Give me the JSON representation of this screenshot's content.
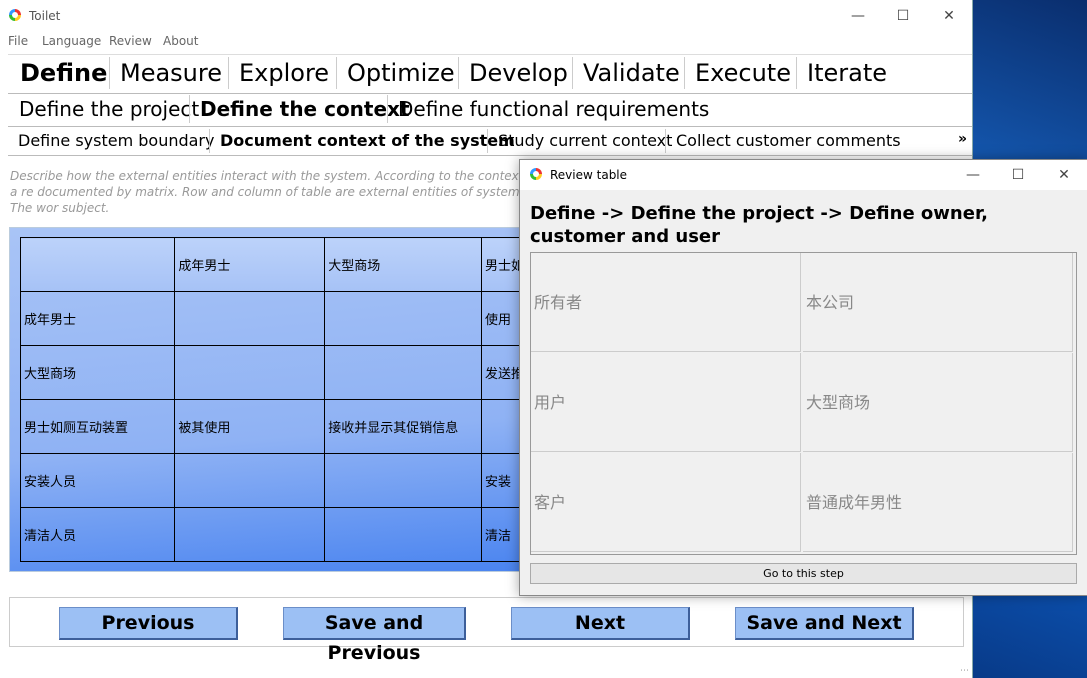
{
  "window": {
    "title": "Toilet"
  },
  "menu": [
    "File",
    "Language",
    "Review",
    "About"
  ],
  "phase_tabs": [
    "Define",
    "Measure",
    "Explore",
    "Optimize",
    "Develop",
    "Validate",
    "Execute",
    "Iterate"
  ],
  "step_tabs": [
    "Define the project",
    "Define the context",
    "Define functional requirements"
  ],
  "substep_tabs": [
    "Define system boundary",
    "Document context of the system",
    "Study current context",
    "Collect customer comments"
  ],
  "more_glyph": "»",
  "description": "Describe how the external entities interact with the system. According to the context, a re documented by matrix. Row and column of table are external entities of system. The wor subject.",
  "matrix": {
    "rows": [
      [
        "",
        "成年男士",
        "大型商场",
        "男士如"
      ],
      [
        "成年男士",
        "",
        "",
        "使用"
      ],
      [
        "大型商场",
        "",
        "",
        "发送推"
      ],
      [
        "男士如厕互动装置",
        "被其使用",
        "接收并显示其促销信息",
        ""
      ],
      [
        "安装人员",
        "",
        "",
        "安装"
      ],
      [
        "清洁人员",
        "",
        "",
        "清洁"
      ]
    ]
  },
  "buttons": {
    "previous": "Previous",
    "save_previous": "Save and Previous",
    "next": "Next",
    "save_next": "Save and Next"
  },
  "review": {
    "title": "Review table",
    "heading": "Define -> Define the project -> Define owner, customer and user",
    "cells": [
      [
        "所有者",
        "本公司"
      ],
      [
        "用户",
        "大型商场"
      ],
      [
        "客户",
        "普通成年男性"
      ]
    ],
    "go_button": "Go to this step"
  }
}
